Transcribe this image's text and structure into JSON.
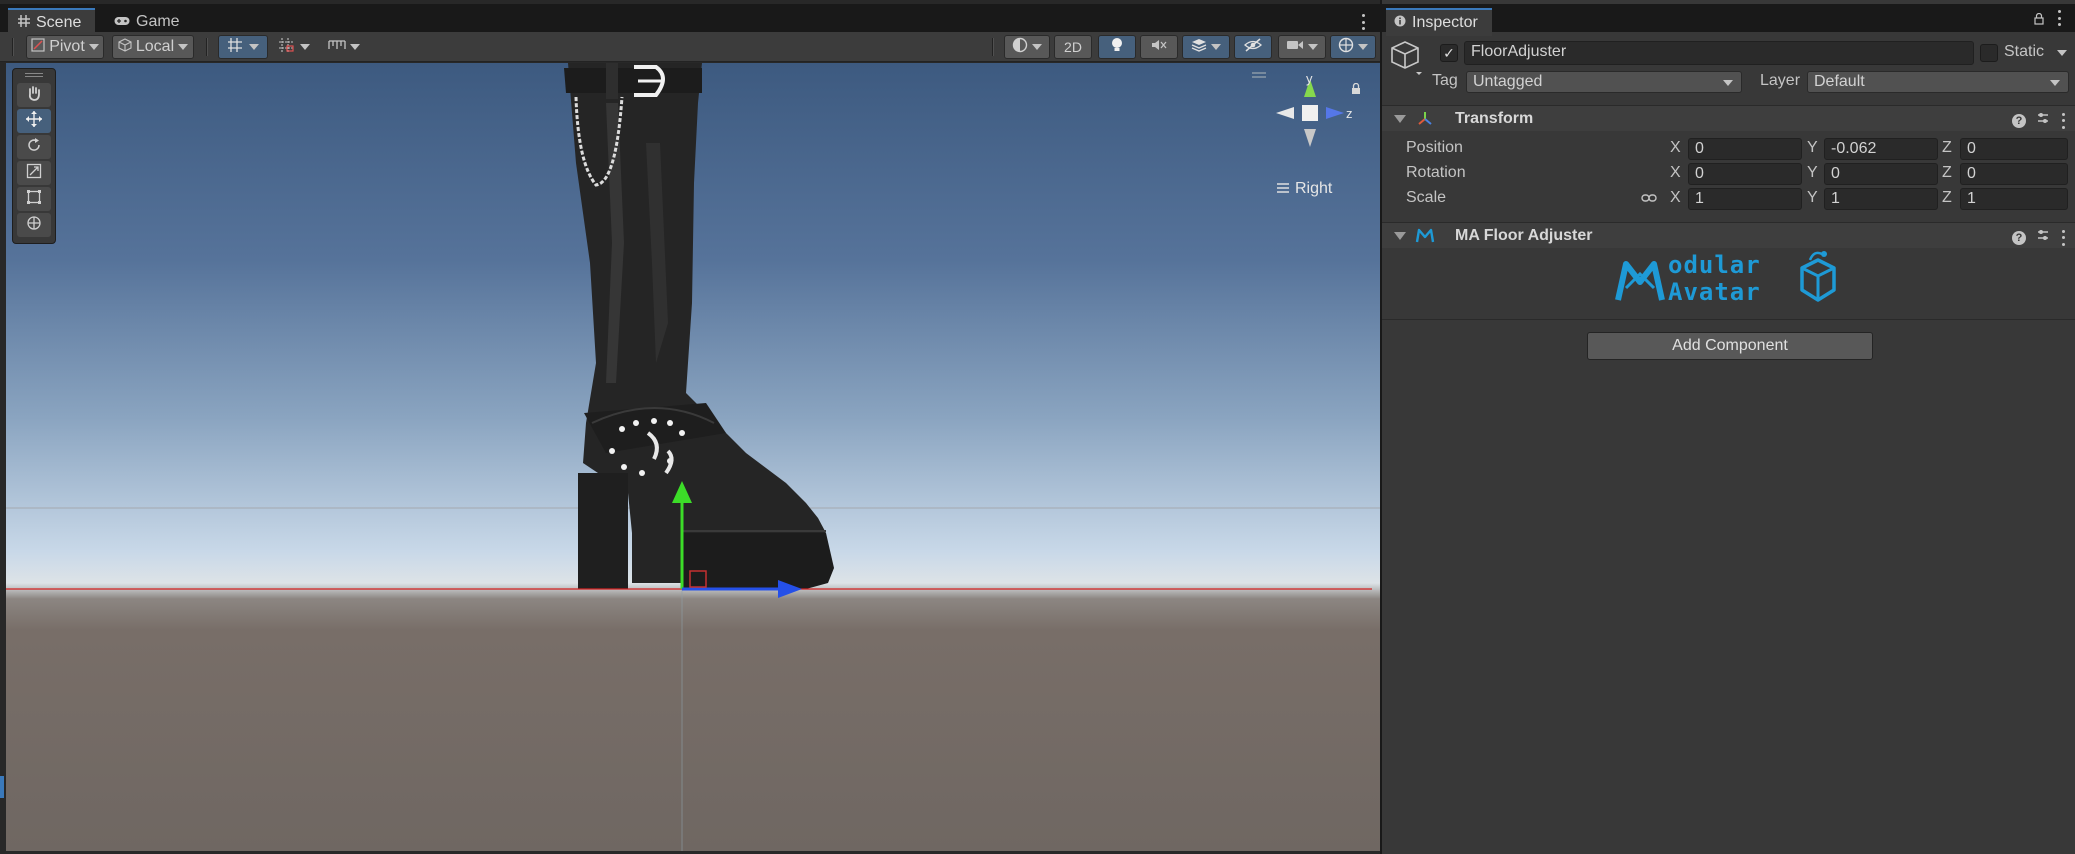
{
  "scene_tabs": [
    {
      "label": "Scene",
      "icon": "grid-icon",
      "active": true
    },
    {
      "label": "Game",
      "icon": "gamepad-icon",
      "active": false
    }
  ],
  "toolbar": {
    "pivot_label": "Pivot",
    "local_label": "Local",
    "twod_label": "2D"
  },
  "viewport": {
    "view_label": "Right",
    "gizmo_axes": {
      "y": "y",
      "z": "z"
    }
  },
  "inspector": {
    "tab_label": "Inspector",
    "object_name": "FloorAdjuster",
    "active_checked": true,
    "static_label": "Static",
    "tag_label": "Tag",
    "tag_value": "Untagged",
    "layer_label": "Layer",
    "layer_value": "Default",
    "transform": {
      "title": "Transform",
      "position_label": "Position",
      "rotation_label": "Rotation",
      "scale_label": "Scale",
      "axis_x": "X",
      "axis_y": "Y",
      "axis_z": "Z",
      "position": {
        "x": "0",
        "y": "-0.062",
        "z": "0"
      },
      "rotation": {
        "x": "0",
        "y": "0",
        "z": "0"
      },
      "scale": {
        "x": "1",
        "y": "1",
        "z": "1"
      }
    },
    "floor_adjuster": {
      "title": "MA Floor Adjuster",
      "logo_line1": "odular",
      "logo_line2": "Avatar"
    },
    "add_component_label": "Add Component"
  },
  "colors": {
    "accent": "#3a79bb",
    "active_button": "#46607c",
    "panel": "#383838",
    "logo": "#1e9ad6"
  }
}
